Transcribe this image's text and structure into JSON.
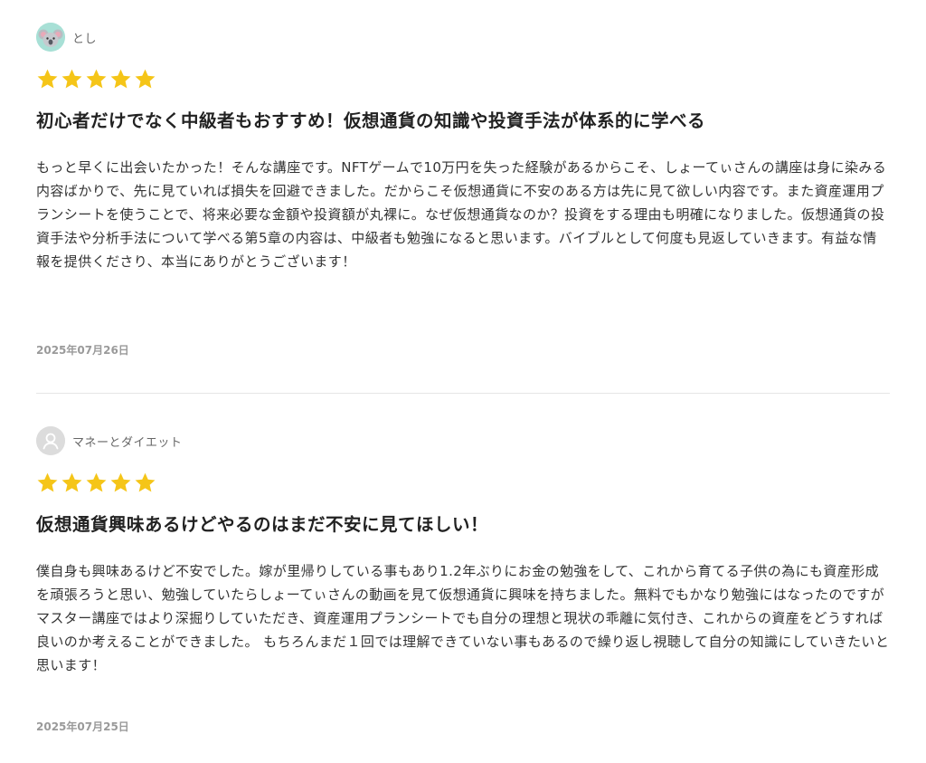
{
  "colors": {
    "star": "#f5c518",
    "title": "#222222",
    "body_text": "#333333",
    "meta_text": "#9a9a9a",
    "divider": "#e6e6e6"
  },
  "reviews": [
    {
      "author": "とし",
      "avatar_icon": "koala-avatar-icon",
      "rating": 5,
      "rating_max": 5,
      "title": "初心者だけでなく中級者もおすすめ！仮想通貨の知識や投資手法が体系的に学べる",
      "body": "もっと早くに出会いたかった！そんな講座です。NFTゲームで10万円を失った経験があるからこそ、しょーてぃさんの講座は身に染みる内容ばかりで、先に見ていれば損失を回避できました。だからこそ仮想通貨に不安のある方は先に見て欲しい内容です。また資産運用プランシートを使うことで、将来必要な金額や投資額が丸裸に。なぜ仮想通貨なのか？投資をする理由も明確になりました。仮想通貨の投資手法や分析手法について学べる第5章の内容は、中級者も勉強になると思います。バイブルとして何度も見返していきます。有益な情報を提供くださり、本当にありがとうございます！",
      "date": "2025年07月26日"
    },
    {
      "author": "マネーとダイエット",
      "avatar_icon": "default-user-avatar-icon",
      "rating": 5,
      "rating_max": 5,
      "title": "仮想通貨興味あるけどやるのはまだ不安に見てほしい！",
      "body": "僕自身も興味あるけど不安でした。嫁が里帰りしている事もあり1.2年ぶりにお金の勉強をして、これから育てる子供の為にも資産形成を頑張ろうと思い、勉強していたらしょーてぃさんの動画を見て仮想通貨に興味を持ちました。無料でもかなり勉強にはなったのですがマスター講座ではより深掘りしていただき、資産運用プランシートでも自分の理想と現状の乖離に気付き、これからの資産をどうすれば良いのか考えることができました。 もちろんまだ１回では理解できていない事もあるので繰り返し視聴して自分の知識にしていきたいと思います！",
      "date": "2025年07月25日"
    }
  ]
}
